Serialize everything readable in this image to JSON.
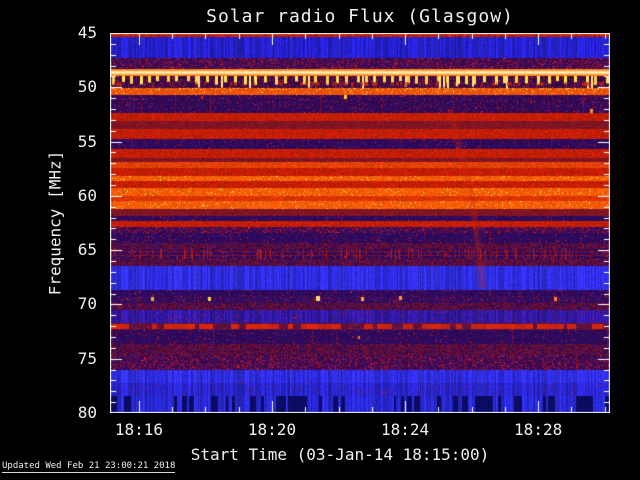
{
  "title": "Solar radio Flux (Glasgow)",
  "footer": {
    "updated_text": "Updated Wed Feb 21 23:00:21 2018"
  },
  "colors": {
    "background": "#000000",
    "frame": "#ffffff",
    "text": "#f0f0f0"
  },
  "chart_data": {
    "type": "heatmap",
    "title": "Solar radio Flux (Glasgow)",
    "xlabel": "Start Time (03-Jan-14 18:15:00)",
    "ylabel": "Frequency [MHz]",
    "grid": false,
    "legend": "none",
    "freq_range_mhz": [
      45,
      80
    ],
    "time_range_minutes": [
      0.13,
      15.16
    ],
    "x_major_ticks": [
      {
        "minute": 1,
        "label": "18:16"
      },
      {
        "minute": 5,
        "label": "18:20"
      },
      {
        "minute": 9,
        "label": "18:24"
      },
      {
        "minute": 13,
        "label": "18:28"
      }
    ],
    "x_minor_tick_minutes": [
      1,
      2,
      3,
      4,
      5,
      6,
      7,
      8,
      9,
      10,
      11,
      12,
      13,
      14,
      15
    ],
    "y_major_ticks": [
      45,
      50,
      55,
      60,
      65,
      70,
      75,
      80
    ],
    "y_minor_step_mhz": 1,
    "palette": {
      "blue": "#2420c8",
      "blueBand": "#2e2ce0",
      "blueMed": "#2824c8",
      "bluePurple": "#3018a0",
      "blueStriated": "#2828d2",
      "blueDark": "#0c0c66",
      "purple": "#2e0a5c",
      "purpleRed": "#3c0a55",
      "purpleSparse": "#320a58",
      "purpleSpikes": "#300a58",
      "dashRow": "#38084a",
      "dotRow": "#320c5e",
      "speckleRed": "#a01828",
      "red": "#c41e06",
      "redBright": "#d42404",
      "darkRed": "#801424",
      "darkRedSpeck": "#6e1030",
      "redOrange": "#dc3404",
      "orange": "#e64206",
      "orangeBright": "#ff5c08",
      "creamEdge": "#ff7c10",
      "creamCenter": "#fff0b4",
      "dashYellow": "#ffd24a",
      "orangeBand": "#ec5208",
      "fleckYellow": "#ffc83c",
      "redDashBright": "#e02808",
      "redDashDim": "#5a1240",
      "frame": "#ffffff"
    },
    "bands": [
      {
        "f0": 45.0,
        "f1": 45.4,
        "type": "redBright"
      },
      {
        "f0": 45.4,
        "f1": 47.3,
        "type": "blue"
      },
      {
        "f0": 47.3,
        "f1": 48.3,
        "type": "purpleRed"
      },
      {
        "f0": 48.3,
        "f1": 49.0,
        "type": "cream"
      },
      {
        "f0": 49.0,
        "f1": 50.1,
        "type": "dashRow"
      },
      {
        "f0": 50.1,
        "f1": 50.7,
        "type": "orangeBand"
      },
      {
        "f0": 50.7,
        "f1": 52.4,
        "type": "purpleSparse"
      },
      {
        "f0": 52.4,
        "f1": 53.1,
        "type": "red"
      },
      {
        "f0": 53.1,
        "f1": 53.8,
        "type": "darkRed"
      },
      {
        "f0": 53.8,
        "f1": 54.8,
        "type": "red"
      },
      {
        "f0": 54.8,
        "f1": 55.7,
        "type": "purple"
      },
      {
        "f0": 55.7,
        "f1": 56.5,
        "type": "red"
      },
      {
        "f0": 56.5,
        "f1": 56.9,
        "type": "darkRed"
      },
      {
        "f0": 56.9,
        "f1": 57.4,
        "type": "orange"
      },
      {
        "f0": 57.4,
        "f1": 58.2,
        "type": "red"
      },
      {
        "f0": 58.2,
        "f1": 58.6,
        "type": "orangeBright"
      },
      {
        "f0": 58.6,
        "f1": 59.3,
        "type": "red"
      },
      {
        "f0": 59.3,
        "f1": 60.0,
        "type": "orangeBright"
      },
      {
        "f0": 60.0,
        "f1": 60.5,
        "type": "redOrange"
      },
      {
        "f0": 60.5,
        "f1": 61.2,
        "type": "orangeBright"
      },
      {
        "f0": 61.2,
        "f1": 61.9,
        "type": "darkRed"
      },
      {
        "f0": 61.9,
        "f1": 62.3,
        "type": "purple"
      },
      {
        "f0": 62.3,
        "f1": 62.9,
        "type": "red"
      },
      {
        "f0": 62.9,
        "f1": 63.4,
        "type": "purpleRed"
      },
      {
        "f0": 63.4,
        "f1": 64.3,
        "type": "purple"
      },
      {
        "f0": 64.3,
        "f1": 64.9,
        "type": "darkRedSpeck"
      },
      {
        "f0": 64.9,
        "f1": 65.8,
        "type": "purpleSpikes"
      },
      {
        "f0": 65.8,
        "f1": 66.5,
        "type": "darkRedSpeck"
      },
      {
        "f0": 66.5,
        "f1": 68.7,
        "type": "blueBand"
      },
      {
        "f0": 68.7,
        "f1": 69.2,
        "type": "purple"
      },
      {
        "f0": 69.2,
        "f1": 69.9,
        "type": "dotRow"
      },
      {
        "f0": 69.9,
        "f1": 70.5,
        "type": "darkRedSpeck"
      },
      {
        "f0": 70.5,
        "f1": 71.7,
        "type": "bluePurple"
      },
      {
        "f0": 71.7,
        "f1": 72.4,
        "type": "redDashed"
      },
      {
        "f0": 72.4,
        "f1": 73.6,
        "type": "purple"
      },
      {
        "f0": 73.6,
        "f1": 74.7,
        "type": "darkRedSpeck"
      },
      {
        "f0": 74.7,
        "f1": 76.0,
        "type": "purpleRed"
      },
      {
        "f0": 76.0,
        "f1": 77.2,
        "type": "blueBand"
      },
      {
        "f0": 77.2,
        "f1": 78.4,
        "type": "blueMed"
      },
      {
        "f0": 78.4,
        "f1": 80.0,
        "type": "blueStriated"
      }
    ],
    "dots": [
      {
        "t": 2.9,
        "f": 50.9,
        "c": "#cc2200",
        "s": 2
      },
      {
        "t": 7.2,
        "f": 50.85,
        "c": "#ffcc33",
        "s": 3
      },
      {
        "t": 14.6,
        "f": 52.2,
        "c": "#ff8833",
        "s": 3
      },
      {
        "t": 1.4,
        "f": 69.5,
        "c": "#ffaa22",
        "s": 3
      },
      {
        "t": 3.1,
        "f": 69.5,
        "c": "#ffd24a",
        "s": 3
      },
      {
        "t": 6.35,
        "f": 69.5,
        "c": "#ffe066",
        "s": 4
      },
      {
        "t": 7.7,
        "f": 69.5,
        "c": "#ffaa22",
        "s": 3
      },
      {
        "t": 8.85,
        "f": 69.4,
        "c": "#ff9922",
        "s": 3
      },
      {
        "t": 13.5,
        "f": 69.5,
        "c": "#ff8822",
        "s": 3
      },
      {
        "t": 7.6,
        "f": 73.0,
        "c": "#ff7722",
        "s": 2
      }
    ],
    "burst_drift": {
      "points": [
        [
          10.35,
          52.0
        ],
        [
          11.0,
          60.0
        ],
        [
          11.35,
          68.5
        ]
      ]
    }
  }
}
